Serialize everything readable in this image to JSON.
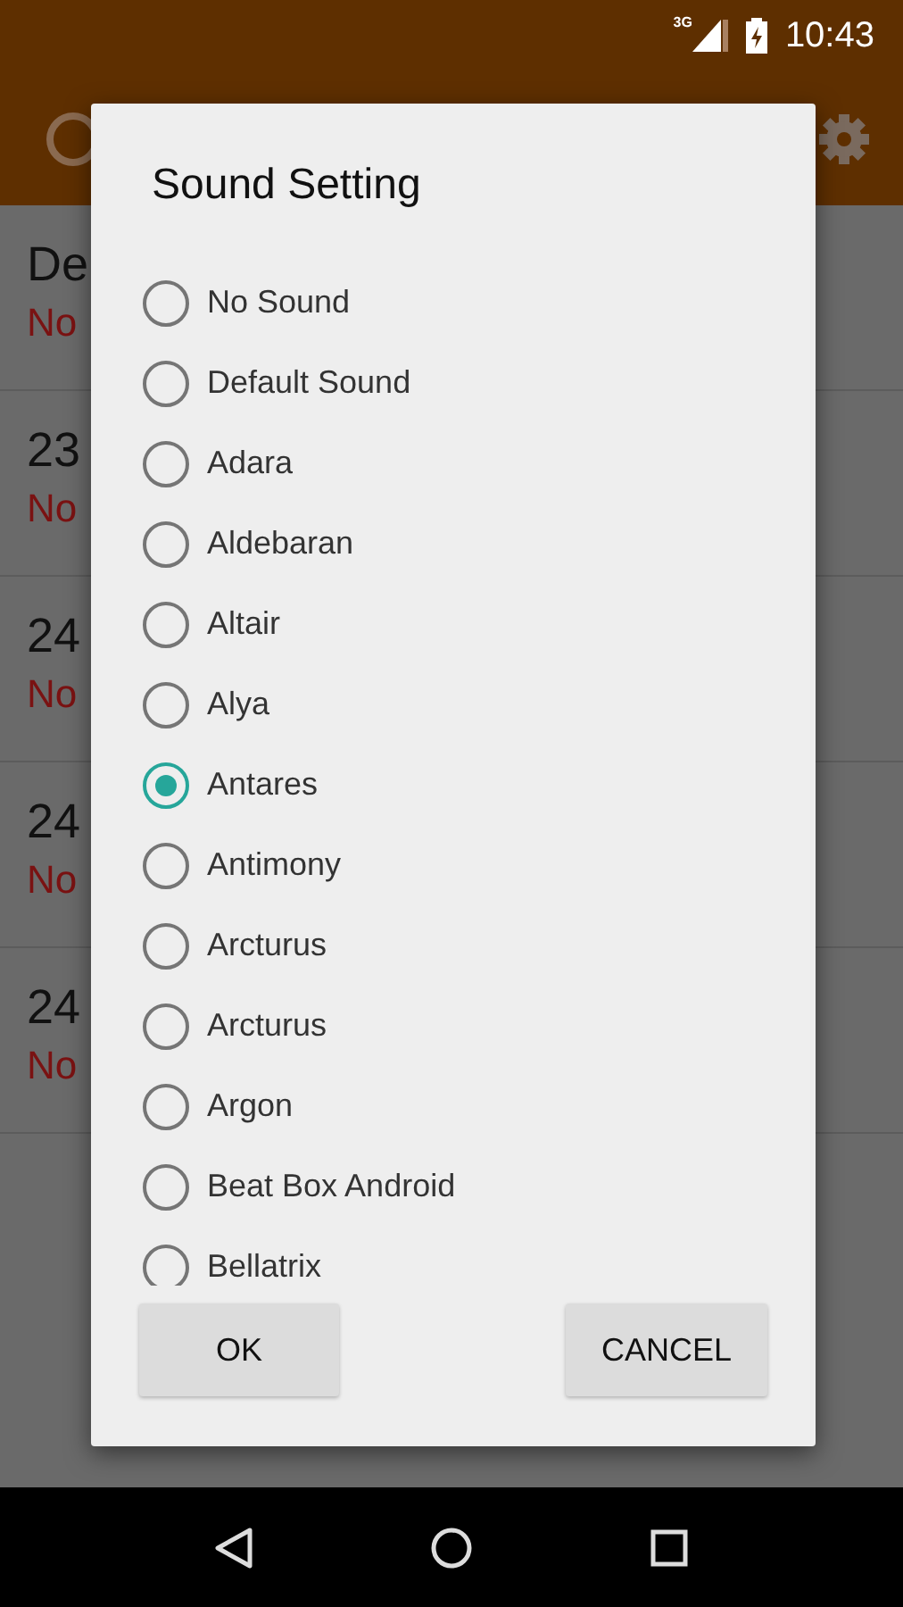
{
  "status_bar": {
    "network": "3G",
    "time": "10:43"
  },
  "background_list": [
    {
      "title": "De",
      "subtitle": "No"
    },
    {
      "title": "23",
      "subtitle": "No"
    },
    {
      "title": "24",
      "subtitle": "No"
    },
    {
      "title": "24",
      "subtitle": "No"
    },
    {
      "title": "24",
      "subtitle": "No"
    }
  ],
  "dialog": {
    "title": "Sound Setting",
    "options": [
      {
        "label": "No Sound",
        "selected": false
      },
      {
        "label": "Default Sound",
        "selected": false
      },
      {
        "label": "Adara",
        "selected": false
      },
      {
        "label": "Aldebaran",
        "selected": false
      },
      {
        "label": "Altair",
        "selected": false
      },
      {
        "label": "Alya",
        "selected": false
      },
      {
        "label": "Antares",
        "selected": true
      },
      {
        "label": "Antimony",
        "selected": false
      },
      {
        "label": "Arcturus",
        "selected": false
      },
      {
        "label": "Arcturus",
        "selected": false
      },
      {
        "label": "Argon",
        "selected": false
      },
      {
        "label": "Beat Box Android",
        "selected": false
      },
      {
        "label": "Bellatrix",
        "selected": false
      }
    ],
    "buttons": [
      "OK",
      "CANCEL"
    ]
  }
}
